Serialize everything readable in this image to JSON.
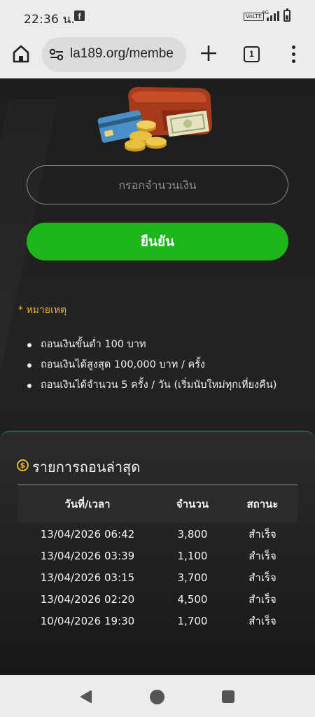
{
  "status_bar": {
    "time": "22:36 น.",
    "volte": "VoLTE",
    "network": "4G",
    "icons": [
      "facebook-icon",
      "signal-icon",
      "battery-icon"
    ]
  },
  "browser": {
    "url": "la189.org/membe",
    "tab_count": "1",
    "icons": [
      "home-icon",
      "site-settings-icon",
      "new-tab-icon",
      "tabs-icon",
      "more-options-icon"
    ]
  },
  "withdraw": {
    "amount_placeholder": "กรอกจำนวนเงิน",
    "confirm_label": "ยืนยัน",
    "confirm_color": "#1eb51c"
  },
  "notes": {
    "title": "* หมายเหตุ",
    "title_color": "#e7b524",
    "items": [
      "ถอนเงินขั้นต่ำ 100 บาท",
      "ถอนเงินได้สูงสุด 100,000 บาท / ครั้ง",
      "ถอนเงินได้จำนวน 5 ครั้ง / วัน (เริ่มนับใหม่ทุกเที่ยงคืน)"
    ]
  },
  "history": {
    "title": "รายการถอนล่าสุด",
    "columns": [
      "วันที่/เวลา",
      "จำนวน",
      "สถานะ"
    ],
    "rows": [
      [
        "13/04/2026 06:42",
        "3,800",
        "สำเร็จ"
      ],
      [
        "13/04/2026 03:39",
        "1,100",
        "สำเร็จ"
      ],
      [
        "13/04/2026 03:15",
        "3,700",
        "สำเร็จ"
      ],
      [
        "13/04/2026 02:20",
        "4,500",
        "สำเร็จ"
      ],
      [
        "10/04/2026 19:30",
        "1,700",
        "สำเร็จ"
      ]
    ]
  },
  "nav_bar": {
    "icons": [
      "back-icon",
      "home-circle-icon",
      "recent-apps-icon"
    ]
  }
}
